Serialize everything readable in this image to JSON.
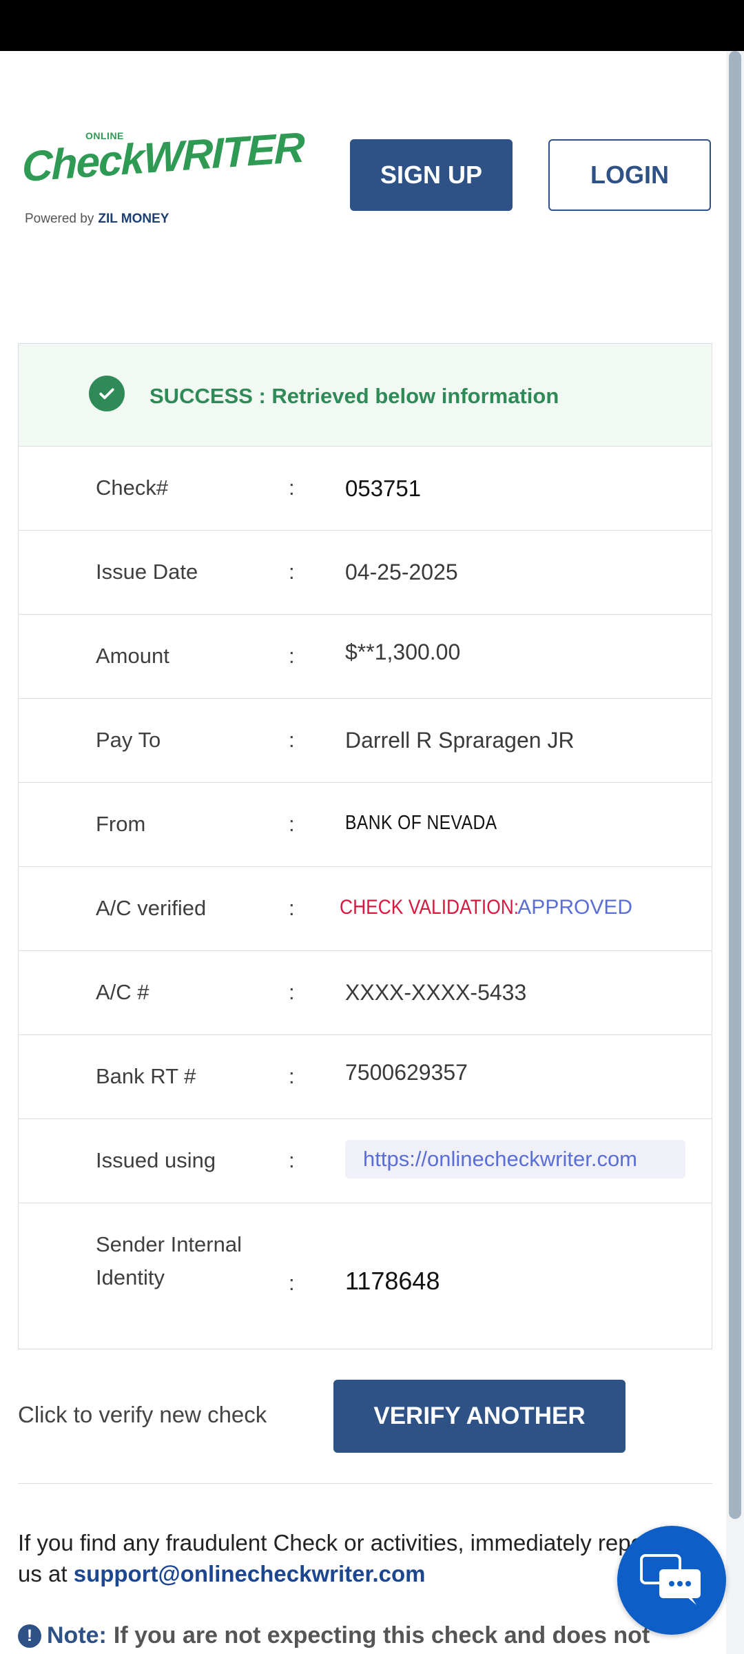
{
  "header": {
    "logo": {
      "online": "ONLINE",
      "brand_check": "Check",
      "brand_writer": "WRITER",
      "powered_by": "Powered by",
      "powered_brand": "ZIL MONEY"
    },
    "signup_label": "SIGN UP",
    "login_label": "LOGIN"
  },
  "result": {
    "success_message": "SUCCESS : Retrieved below information",
    "colon": ":",
    "rows": [
      {
        "label": "Check#",
        "value": "053751"
      },
      {
        "label": "Issue Date",
        "value": "04-25-2025"
      },
      {
        "label": "Amount",
        "value": "$**1,300.00"
      },
      {
        "label": "Pay To",
        "value": "Darrell R Spraragen JR"
      },
      {
        "label": "From",
        "value": "BANK OF NEVADA"
      },
      {
        "label": "A/C verified",
        "value_prefix": "CHECK VALIDATION:",
        "value_status": "APPROVED"
      },
      {
        "label": "A/C #",
        "value": "XXXX-XXXX-5433"
      },
      {
        "label": "Bank RT #",
        "value": "7500629357"
      },
      {
        "label": "Issued using",
        "value": "https://onlinecheckwriter.com"
      },
      {
        "label": "Sender Internal Identity",
        "value": "1178648"
      }
    ]
  },
  "verify": {
    "prompt": "Click to verify new check",
    "button_label": "VERIFY ANOTHER"
  },
  "fraud": {
    "text": "If you find any fraudulent Check or activities, immediately report to us at",
    "email": "support@onlinecheckwriter.com"
  },
  "note": {
    "label": "Note:",
    "text": "If you are not expecting this check and does not"
  },
  "icons": {
    "success": "check-circle-icon",
    "note": "exclamation-circle-icon",
    "chat": "chat-bubble-icon"
  },
  "colors": {
    "primary": "#2e5186",
    "success": "#2e8b57",
    "danger": "#d7193f",
    "approved": "#5a6ed6",
    "chat": "#0d5fc7"
  }
}
